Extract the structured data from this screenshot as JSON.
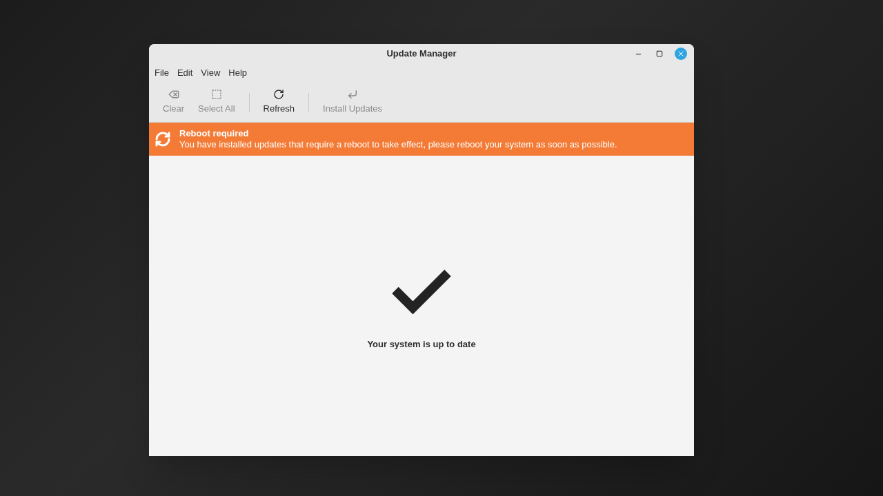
{
  "window": {
    "title": "Update Manager"
  },
  "menu": [
    "File",
    "Edit",
    "View",
    "Help"
  ],
  "toolbar": [
    {
      "kind": "clear",
      "label": "Clear",
      "disabled": true
    },
    {
      "kind": "select",
      "label": "Select All",
      "disabled": true
    },
    {
      "kind": "separator"
    },
    {
      "kind": "refresh",
      "label": "Refresh",
      "disabled": false
    },
    {
      "kind": "separator"
    },
    {
      "kind": "install",
      "label": "Install Updates",
      "disabled": true
    }
  ],
  "banner": {
    "title": "Reboot required",
    "message": "You have installed updates that require a reboot to take effect, please reboot your system as soon as possible."
  },
  "status": {
    "message": "Your system is up to date"
  }
}
